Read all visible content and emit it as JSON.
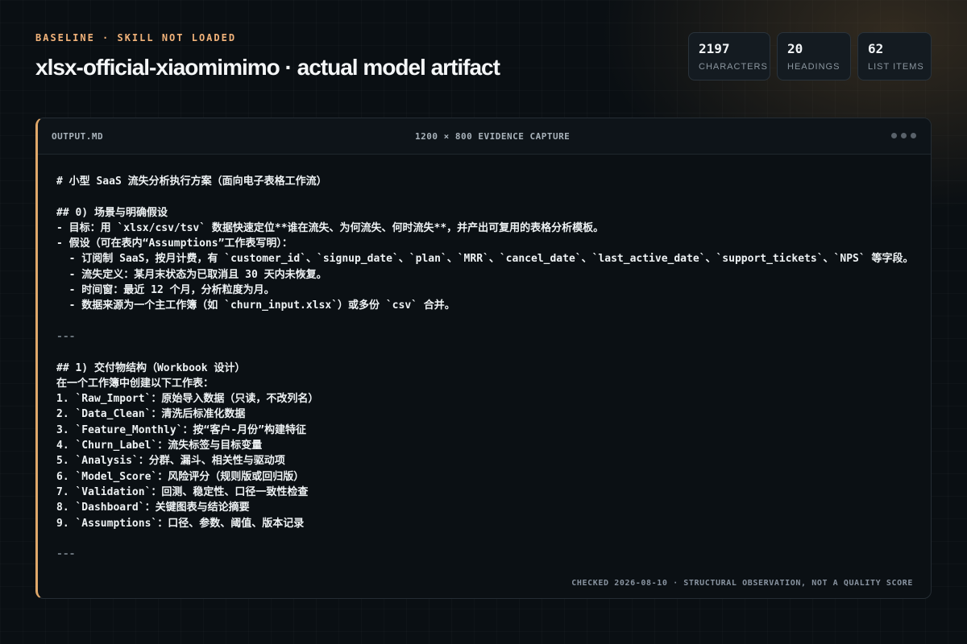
{
  "header": {
    "eyebrow": "BASELINE · SKILL NOT LOADED",
    "title": "xlsx-official-xiaomimimo · actual model artifact"
  },
  "stats": [
    {
      "value": "2197",
      "label": "CHARACTERS"
    },
    {
      "value": "20",
      "label": "HEADINGS"
    },
    {
      "value": "62",
      "label": "LIST ITEMS"
    }
  ],
  "panel": {
    "filename": "OUTPUT.MD",
    "caption": "1200 × 800 EVIDENCE CAPTURE",
    "footer": "CHECKED 2026-08-10 · STRUCTURAL OBSERVATION, NOT A QUALITY SCORE"
  },
  "content": {
    "lines": [
      "# 小型 SaaS 流失分析执行方案（面向电子表格工作流）",
      "",
      "## 0) 场景与明确假设",
      "- 目标：用 `xlsx/csv/tsv` 数据快速定位**谁在流失、为何流失、何时流失**，并产出可复用的表格分析模板。",
      "- 假设（可在表内“Assumptions”工作表写明）：",
      "  - 订阅制 SaaS，按月计费，有 `customer_id`、`signup_date`、`plan`、`MRR`、`cancel_date`、`last_active_date`、`support_tickets`、`NPS` 等字段。",
      "  - 流失定义：某月末状态为已取消且 30 天内未恢复。",
      "  - 时间窗：最近 12 个月，分析粒度为月。",
      "  - 数据来源为一个主工作簿（如 `churn_input.xlsx`）或多份 `csv` 合并。",
      "",
      "---",
      "",
      "## 1) 交付物结构（Workbook 设计）",
      "在一个工作簿中创建以下工作表：",
      "1. `Raw_Import`：原始导入数据（只读，不改列名）",
      "2. `Data_Clean`：清洗后标准化数据",
      "3. `Feature_Monthly`：按“客户-月份”构建特征",
      "4. `Churn_Label`：流失标签与目标变量",
      "5. `Analysis`：分群、漏斗、相关性与驱动项",
      "6. `Model_Score`：风险评分（规则版或回归版）",
      "7. `Validation`：回测、稳定性、口径一致性检查",
      "8. `Dashboard`：关键图表与结论摘要",
      "9. `Assumptions`：口径、参数、阈值、版本记录",
      "",
      "---"
    ]
  }
}
